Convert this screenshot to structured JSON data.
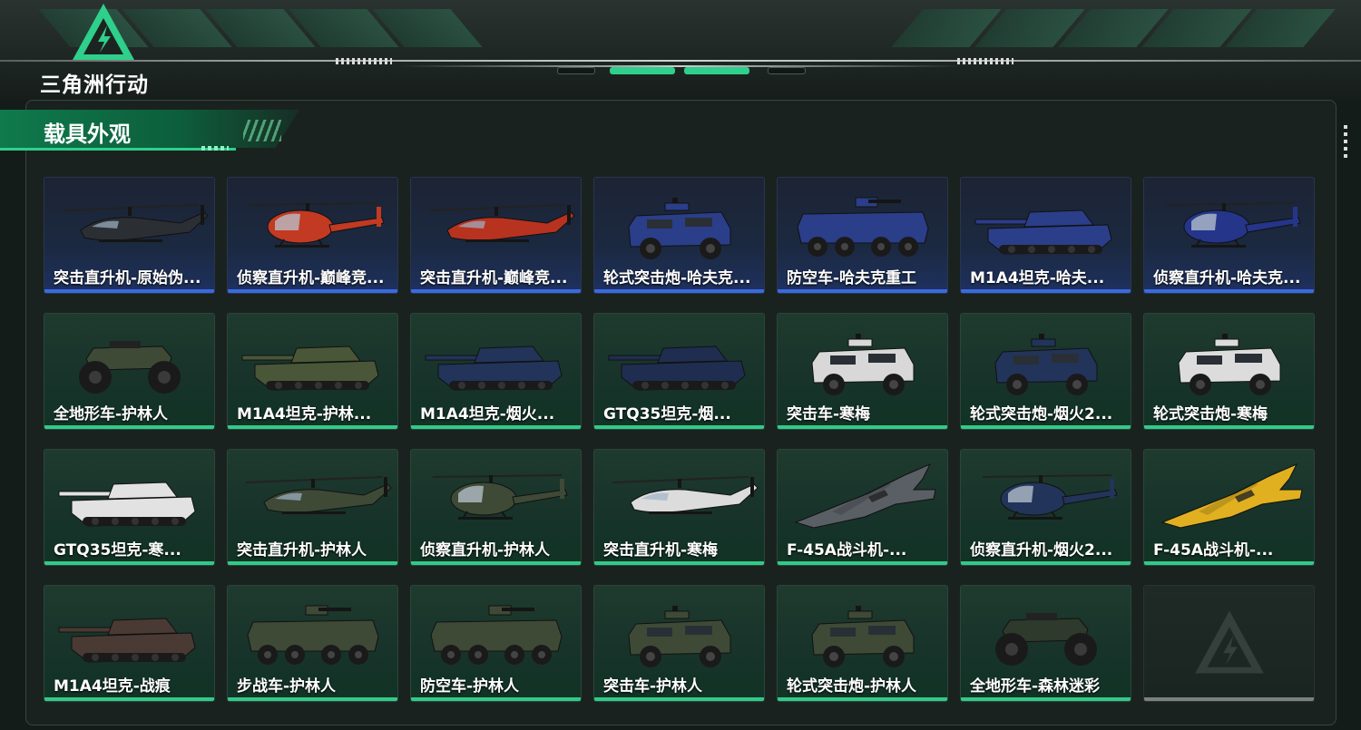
{
  "logo": {
    "text": "三角洲行动",
    "icon": "delta-triangle-logo"
  },
  "section": {
    "title": "载具外观"
  },
  "colors": {
    "accent_green": "#2fcf8c",
    "rare_blue": "#3a6ae0",
    "empty_gray": "#7c807e"
  },
  "items": [
    {
      "name": "突击直升机-原始伪...",
      "rarity": "blue",
      "icon": "attack-helicopter-icon",
      "tint": "#2b2f33"
    },
    {
      "name": "侦察直升机-巅峰竞...",
      "rarity": "blue",
      "icon": "scout-helicopter-icon",
      "tint": "#c23a22"
    },
    {
      "name": "突击直升机-巅峰竞...",
      "rarity": "blue",
      "icon": "attack-helicopter-icon",
      "tint": "#b83220"
    },
    {
      "name": "轮式突击炮-哈夫克...",
      "rarity": "blue",
      "icon": "armored-car-icon",
      "tint": "#2a3e8a"
    },
    {
      "name": "防空车-哈夫克重工",
      "rarity": "blue",
      "icon": "apc-icon",
      "tint": "#2a3e8a"
    },
    {
      "name": "M1A4坦克-哈夫...",
      "rarity": "blue",
      "icon": "tank-icon",
      "tint": "#2a3e8a"
    },
    {
      "name": "侦察直升机-哈夫克...",
      "rarity": "blue",
      "icon": "scout-helicopter-icon",
      "tint": "#24358a"
    },
    {
      "name": "全地形车-护林人",
      "rarity": "green",
      "icon": "atv-icon",
      "tint": "#3e4a36"
    },
    {
      "name": "M1A4坦克-护林...",
      "rarity": "green",
      "icon": "tank-icon",
      "tint": "#4a5638"
    },
    {
      "name": "M1A4坦克-烟火...",
      "rarity": "green",
      "icon": "tank-icon",
      "tint": "#22345a"
    },
    {
      "name": "GTQ35坦克-烟...",
      "rarity": "green",
      "icon": "tank-icon",
      "tint": "#1f2d50"
    },
    {
      "name": "突击车-寒梅",
      "rarity": "green",
      "icon": "armored-car-icon",
      "tint": "#d8d8d8"
    },
    {
      "name": "轮式突击炮-烟火2...",
      "rarity": "green",
      "icon": "armored-car-icon",
      "tint": "#22345a"
    },
    {
      "name": "轮式突击炮-寒梅",
      "rarity": "green",
      "icon": "armored-car-icon",
      "tint": "#dcdcdc"
    },
    {
      "name": "GTQ35坦克-寒...",
      "rarity": "green",
      "icon": "tank-icon",
      "tint": "#e2e2e2"
    },
    {
      "name": "突击直升机-护林人",
      "rarity": "green",
      "icon": "attack-helicopter-icon",
      "tint": "#3e4a36"
    },
    {
      "name": "侦察直升机-护林人",
      "rarity": "green",
      "icon": "scout-helicopter-icon",
      "tint": "#3e4a36"
    },
    {
      "name": "突击直升机-寒梅",
      "rarity": "green",
      "icon": "attack-helicopter-icon",
      "tint": "#dcdcdc"
    },
    {
      "name": "F-45A战斗机-...",
      "rarity": "green",
      "icon": "fighter-jet-icon",
      "tint": "#5a5f66"
    },
    {
      "name": "侦察直升机-烟火2...",
      "rarity": "green",
      "icon": "scout-helicopter-icon",
      "tint": "#22345a"
    },
    {
      "name": "F-45A战斗机-...",
      "rarity": "green",
      "icon": "fighter-jet-icon",
      "tint": "#e0b020"
    },
    {
      "name": "M1A4坦克-战痕",
      "rarity": "green",
      "icon": "tank-icon",
      "tint": "#4a3a34"
    },
    {
      "name": "步战车-护林人",
      "rarity": "green",
      "icon": "apc-icon",
      "tint": "#3e4a36"
    },
    {
      "name": "防空车-护林人",
      "rarity": "green",
      "icon": "apc-icon",
      "tint": "#3e4a36"
    },
    {
      "name": "突击车-护林人",
      "rarity": "green",
      "icon": "armored-car-icon",
      "tint": "#3e4a36"
    },
    {
      "name": "轮式突击炮-护林人",
      "rarity": "green",
      "icon": "armored-car-icon",
      "tint": "#3e4a36"
    },
    {
      "name": "全地形车-森林迷彩",
      "rarity": "green",
      "icon": "atv-icon",
      "tint": "#2e3a2c"
    },
    {
      "name": "",
      "rarity": "empty",
      "icon": "delta-triangle-logo",
      "tint": ""
    }
  ]
}
